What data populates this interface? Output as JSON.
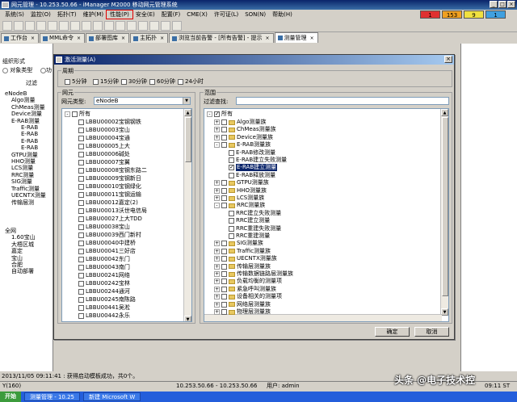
{
  "window": {
    "title": "网元管理 - 10.253.50.66 - iManager M2000 移动网元管理系统"
  },
  "menu": {
    "items": [
      "系统(S)",
      "监控(O)",
      "拓扑(T)",
      "维护(M)",
      "性能(P)",
      "安全(E)",
      "配置(F)",
      "CME(X)",
      "许可证(L)",
      "SON(N)",
      "帮助(H)"
    ],
    "highlighted": "性能(P)",
    "alarms": [
      {
        "value": "1",
        "color": "#e03030"
      },
      {
        "value": "153",
        "color": "#f0a020"
      },
      {
        "value": "9",
        "color": "#f0e040"
      },
      {
        "value": "1",
        "color": "#40a0e0"
      }
    ]
  },
  "tabs": [
    {
      "label": "工作台",
      "active": false
    },
    {
      "label": "MML命令",
      "active": false
    },
    {
      "label": "部署图库",
      "active": false
    },
    {
      "label": "主拓扑",
      "active": false
    },
    {
      "label": "浏览当前告警 - [所有告警] - 提示",
      "active": false
    },
    {
      "label": "测量管理",
      "active": true
    }
  ],
  "left_panel": {
    "section": "组织形式",
    "radio_obj": "对象类型",
    "radio_func": "功",
    "filter_label": "过滤",
    "tree": [
      "eNodeB",
      "Algo测量",
      "ChMeas测量",
      "Device测量",
      "E-RAB测量",
      "E-RAB",
      "E-RAB",
      "E-RAB",
      "E-RAB",
      "GTPU测量",
      "HHO测量",
      "LCS测量",
      "RRC测量",
      "SIG测量",
      "Traffic测量",
      "UECNTX测量",
      "传输层测"
    ],
    "tree2": [
      "全网",
      "1.60宝山",
      "大梧区城",
      "嘉定",
      "宝山",
      "合肥",
      "自动部署"
    ]
  },
  "dialog": {
    "title": "激活测量(A)",
    "period": {
      "label": "周期",
      "options": [
        "5分钟",
        "15分钟",
        "30分钟",
        "60分钟",
        "24小时"
      ]
    },
    "ne": {
      "label": "网元",
      "type_label": "网元类型:",
      "type_value": "eNodeB",
      "root": "所有",
      "items": [
        "LBBU00002宝钢钢铁",
        "LBBU00003宝山",
        "LBBU00004宝通",
        "LBBU00005上大",
        "LBBU00006碱处",
        "LBBU00007宝翼",
        "LBBU00008宝钢东路二",
        "LBBU00009宝钢新日",
        "LBBU00010宝钢绿化",
        "LBBU00011宝钢运输",
        "LBBU00012嘉定(2)",
        "LBBU00013沃世电信局",
        "LBBU00027上大TDD",
        "LBBU00038宝山",
        "LBBU00039西门新村",
        "LBBU00040中建桥",
        "LBBU00041三好店",
        "LBBU00042东门",
        "LBBU00043南门",
        "LBBU00241网络",
        "LBBU00242宝林",
        "LBBU00244通河",
        "LBBU00245南陈路",
        "LBBU00441吴淞",
        "LBBU00442永乐"
      ]
    },
    "scope": {
      "label": "范围",
      "filter_label": "过滤查找:",
      "root": "所有",
      "items": [
        {
          "label": "Algo测量族",
          "level": 1,
          "expander": "+",
          "folder": true,
          "checked": false
        },
        {
          "label": "ChMeas测量族",
          "level": 1,
          "expander": "+",
          "folder": true,
          "checked": false
        },
        {
          "label": "Device测量族",
          "level": 1,
          "expander": "+",
          "folder": true,
          "checked": false
        },
        {
          "label": "E-RAB测量族",
          "level": 1,
          "expander": "-",
          "folder": true,
          "checked": false
        },
        {
          "label": "E-RAB修改测量",
          "level": 2,
          "expander": "",
          "folder": false,
          "checked": false
        },
        {
          "label": "E-RAB建立失败测量",
          "level": 2,
          "expander": "",
          "folder": false,
          "checked": false
        },
        {
          "label": "E-RAB建立测量",
          "level": 2,
          "expander": "",
          "folder": false,
          "checked": true,
          "selected": true
        },
        {
          "label": "E-RAB释放测量",
          "level": 2,
          "expander": "",
          "folder": false,
          "checked": false
        },
        {
          "label": "GTPU测量族",
          "level": 1,
          "expander": "+",
          "folder": true,
          "checked": false
        },
        {
          "label": "HHO测量族",
          "level": 1,
          "expander": "+",
          "folder": true,
          "checked": false
        },
        {
          "label": "LCS测量族",
          "level": 1,
          "expander": "+",
          "folder": true,
          "checked": false
        },
        {
          "label": "RRC测量族",
          "level": 1,
          "expander": "-",
          "folder": true,
          "checked": false
        },
        {
          "label": "RRC建立失败测量",
          "level": 2,
          "expander": "",
          "folder": false,
          "checked": false
        },
        {
          "label": "RRC建立测量",
          "level": 2,
          "expander": "",
          "folder": false,
          "checked": false
        },
        {
          "label": "RRC重建失败测量",
          "level": 2,
          "expander": "",
          "folder": false,
          "checked": false
        },
        {
          "label": "RRC重建测量",
          "level": 2,
          "expander": "",
          "folder": false,
          "checked": false
        },
        {
          "label": "SIG测量族",
          "level": 1,
          "expander": "+",
          "folder": true,
          "checked": false
        },
        {
          "label": "Traffic测量族",
          "level": 1,
          "expander": "+",
          "folder": true,
          "checked": false
        },
        {
          "label": "UECNTX测量族",
          "level": 1,
          "expander": "+",
          "folder": true,
          "checked": false
        },
        {
          "label": "传输层测量族",
          "level": 1,
          "expander": "+",
          "folder": true,
          "checked": false
        },
        {
          "label": "传输数据链路层测量族",
          "level": 1,
          "expander": "+",
          "folder": true,
          "checked": false
        },
        {
          "label": "负载均衡的测量项",
          "level": 1,
          "expander": "+",
          "folder": true,
          "checked": false
        },
        {
          "label": "紧急呼叫测量族",
          "level": 1,
          "expander": "+",
          "folder": true,
          "checked": false
        },
        {
          "label": "设备相关的测量项",
          "level": 1,
          "expander": "+",
          "folder": true,
          "checked": false
        },
        {
          "label": "网络层测量族",
          "level": 1,
          "expander": "+",
          "folder": true,
          "checked": false
        },
        {
          "label": "物理层测量族",
          "level": 1,
          "expander": "+",
          "folder": true,
          "checked": false
        }
      ]
    },
    "ok_label": "确定",
    "cancel_label": "取消"
  },
  "log_line": "2013/11/05 09:11:41 : 获得启动模板成功，共0个。",
  "status": {
    "hint": "Y(160)",
    "server": "10.253.50.66 - 10.253.50.66",
    "user": "用户: admin",
    "time": "09:11 ST"
  },
  "taskbar": {
    "start": "开始",
    "tasks": [
      "测量管理 - 10.25",
      "新建 Microsoft W"
    ]
  },
  "watermark": "头条 @电子技术控"
}
